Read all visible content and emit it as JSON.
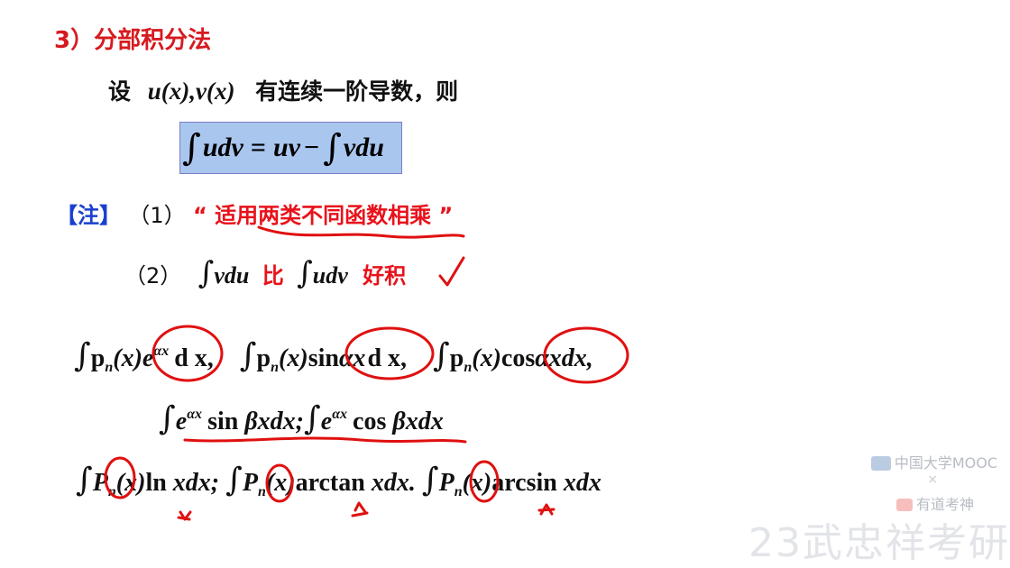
{
  "heading": {
    "section_title": "3）分部积分法"
  },
  "intro": {
    "prefix": "设",
    "funcs": "u(x),v(x)",
    "suffix": "有连续一阶导数，则"
  },
  "formula": {
    "lhs": "udv",
    "equals": "=",
    "uv": "uv",
    "minus": "−",
    "rhs": "vdu",
    "integral": "∫"
  },
  "notes": {
    "tag": "【注】",
    "item1_num": "（1）",
    "item1_open_quote": "“",
    "item1_text": "适用两类不同函数相乘",
    "item1_close_quote": "”",
    "item2_num": "（2）",
    "item2_vdu": "vdu",
    "item2_bi": "比",
    "item2_udv": "udv",
    "item2_haoji": "好积"
  },
  "examples": {
    "row1": [
      {
        "p": "p",
        "n": "n",
        "x": "(x)",
        "e": "e",
        "ax": "αx",
        "tail": "d x,"
      },
      {
        "p": "p",
        "n": "n",
        "x": "(x)",
        "mid": "sin",
        "ax": "αx",
        "tail": "d x,"
      },
      {
        "p": "p",
        "n": "n",
        "x": "(x)",
        "mid": "cos",
        "ax": "αx",
        "tail": "dx,"
      }
    ],
    "row2": {
      "e": "e",
      "ax": "αx",
      "sin": "sin",
      "bx1": "βxdx;",
      "cos": "cos",
      "bx2": "βxdx"
    },
    "row3": [
      {
        "P": "P",
        "n": "n",
        "x": "(x)",
        "fn": "ln",
        "tail": "xdx;"
      },
      {
        "P": "P",
        "n": "n",
        "x": "(x)",
        "fn": "arctan",
        "tail": "xdx."
      },
      {
        "P": "P",
        "n": "n",
        "x": "(x)",
        "fn": "arcsin",
        "tail": "xdx"
      }
    ]
  },
  "watermark": {
    "mooc": "中国大学MOOC",
    "times": "×",
    "youdao": "有道考神",
    "big_text": "23武忠祥考研"
  },
  "colors": {
    "heading_red": "#d71a1f",
    "note_red": "#e8121b",
    "note_blue": "#1a3fd0",
    "formula_bg": "#a9c6ee",
    "ink_red": "#e01010"
  }
}
